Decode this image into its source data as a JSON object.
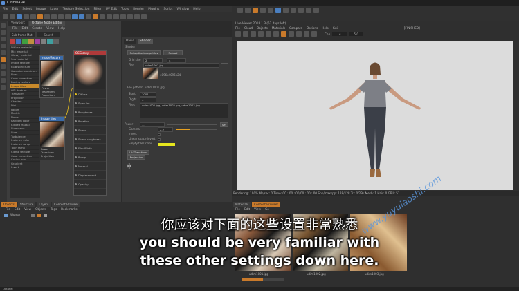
{
  "window": {
    "title": "CINEMA 4D"
  },
  "menu": [
    "File",
    "Edit",
    "Select",
    "Image",
    "Layer",
    "Texture Selection",
    "Filter",
    "UV Edit",
    "Tools",
    "Render",
    "Plugins",
    "Script",
    "Window",
    "Help"
  ],
  "layout": {
    "label": "Layout:",
    "value": "UV Edit"
  },
  "node_editor": {
    "tabs": [
      "Viewport",
      "Octane Node Editor"
    ],
    "menu": [
      "File",
      "Edit",
      "Create",
      "View",
      "Help"
    ],
    "material_label": "Sub frame Mat",
    "search_label": "Search",
    "node_list": [
      "Diffuse material",
      "Mix material",
      "Glossy material",
      "Sub material",
      "Image texture",
      "RGB spectrum",
      "Gaussian spectrum",
      "Float",
      "Color correction",
      "Baking texture",
      "Image tiles",
      "OSL texture",
      "Transform",
      "Projection",
      "Checker",
      "Dirt",
      "Falloff",
      "Marble",
      "Noise",
      "Random color",
      "Ridged fractal",
      "Sine wave",
      "Side",
      "Turbulence",
      "Instance color",
      "Instance range",
      "Toon ramp",
      "Clamp texture",
      "Color correction",
      "Cosine mix",
      "Gradient",
      "Invert"
    ],
    "highlighted_index": 10,
    "nodes": {
      "image_texture": {
        "title": "ImageTexture",
        "ports": [
          "Power",
          "Transform",
          "Projection"
        ]
      },
      "image_tiles": {
        "title": "Image tiles",
        "ports": [
          "Power",
          "Transform",
          "Projection"
        ]
      },
      "material": {
        "title": "OCGlossy",
        "ports": [
          "Diffuse",
          "Specular",
          "Roughness",
          "Rotation",
          "Sheen",
          "Sheen roughness",
          "Film Width",
          "Bump",
          "Normal",
          "Displacement",
          "Opacity"
        ]
      }
    }
  },
  "attributes": {
    "tabs": [
      "Basic",
      "Shader"
    ],
    "section": "Shader",
    "setup_button": "Setup the image tiles",
    "reload_button": "Reload",
    "grid_size_label": "Grid size",
    "grid_x": "2",
    "grid_y": "4",
    "file_label": "File",
    "file_value": "udim1001.jpg",
    "resolution": "4096x4096x24",
    "pattern_label": "File pattern",
    "pattern_value": "udim1001.jpg",
    "start_label": "Start",
    "start_value": "1001",
    "digits_label": "Digits",
    "digits_value": "4",
    "files_label": "Files",
    "files_value": "udim1001.jpg, udim1002.jpg, udim1003.jpg",
    "power_label": "Power",
    "power_value": "1.",
    "gamma_label": "Gamma",
    "gamma_value": "2.2",
    "invert_label": "Invert",
    "linear_label": "Linear space invert",
    "empty_label": "Empty tiles color",
    "uv_button": "UV Transform",
    "proj_button": "Projection",
    "set_button": "Set"
  },
  "live_viewer": {
    "title": "Live Viewer 2018.1.3 (52 days left)",
    "menu": [
      "File",
      "Cloud",
      "Objects",
      "Materials",
      "Compare",
      "Options",
      "Help",
      "Gui"
    ],
    "channel": "Chn",
    "mode": "[FINISHED]",
    "render_value": "5.0",
    "status": "Rendering: 100%  Ms/sec: 0   Time: 00 : 00 : 00/00 : 00 : 00   Spp/maxspp: 128/128   Tri: 0/29k   Mesh: 1   Hair: 0   GPU: 51"
  },
  "objects_panel": {
    "tabs": [
      "Objects",
      "Structure",
      "Layers",
      "Content Browser"
    ],
    "menu": [
      "File",
      "Edit",
      "View",
      "Objects",
      "Tags",
      "Bookmarks"
    ],
    "item": "Woman"
  },
  "asset_panel": {
    "tabs": [
      "Materials",
      "Content Browser"
    ],
    "menu": [
      "File",
      "Edit",
      "View",
      "Go"
    ],
    "thumbs": [
      "udim1001.jpg",
      "udim1002.jpg",
      "udim1003.jpg"
    ]
  },
  "bottom_status": "Octane:",
  "subtitles": {
    "zh": "你应该对下面的这些设置非常熟悉",
    "en1": "you should be very familiar with",
    "en2": "these other settings down here."
  },
  "watermark": "www.yuyuiaoshi.com",
  "colors": {
    "accent": "#c97a2b",
    "highlight": "#e6c020",
    "empty_tile": "#e6e61e"
  }
}
